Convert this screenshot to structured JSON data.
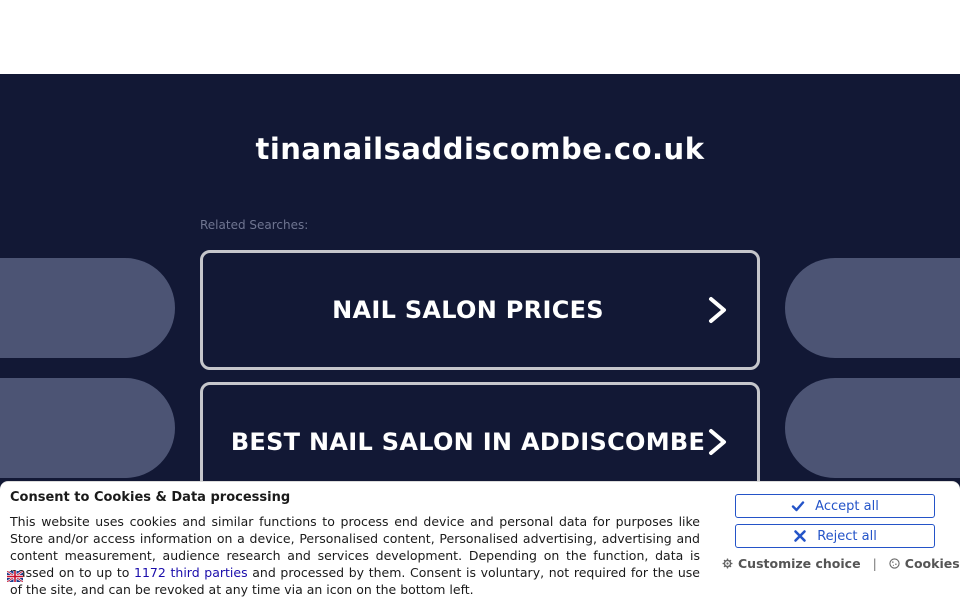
{
  "header": {
    "domain": "tinanailsaddiscombe.co.uk"
  },
  "related": {
    "label": "Related Searches:",
    "items": [
      {
        "label": "NAIL SALON PRICES"
      },
      {
        "label": "BEST NAIL SALON IN ADDISCOMBE"
      }
    ]
  },
  "consent": {
    "title": "Consent to Cookies & Data processing",
    "text_before": "This website uses cookies and similar functions to process end device and personal data for purposes like Store and/or access information on a device, Personalised content, Personalised advertising, advertising and content measurement, audience research and services development. Depending on the function, data is passed on to up to ",
    "link": "1172 third parties",
    "text_after": " and processed by them. Consent is voluntary, not required for the use of the site, and can be revoked at any time via an icon on the bottom left.",
    "accept_label": "Accept all",
    "reject_label": "Reject all",
    "customize_label": "Customize choice",
    "separator": "|",
    "cookies_label": "Cookies"
  },
  "colors": {
    "background": "#121835",
    "side_pill": "#4c5474",
    "button_border": "#c5c6cb",
    "consent_accent": "#2454c8"
  },
  "icons": {
    "chevron": "chevron-right-icon",
    "accept": "check-icon",
    "reject": "close-icon",
    "customize": "gear-icon",
    "cookies": "cookie-icon",
    "flag": "uk-flag-icon"
  }
}
